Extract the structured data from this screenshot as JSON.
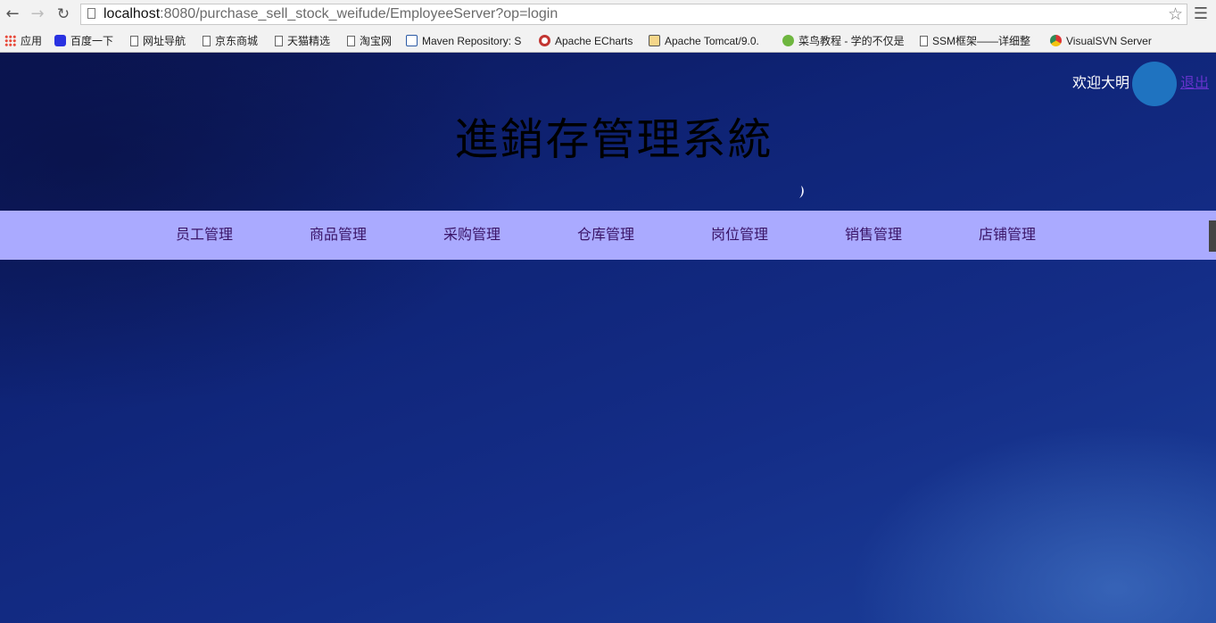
{
  "browser": {
    "url_host": "localhost",
    "url_rest": ":8080/purchase_sell_stock_weifude/EmployeeServer?op=login",
    "bookmarks": [
      {
        "label": "应用",
        "icon": "apps-icon"
      },
      {
        "label": "百度一下",
        "icon": "baidu-icon"
      },
      {
        "label": "网址导航",
        "icon": "page-icon"
      },
      {
        "label": "京东商城",
        "icon": "page-icon"
      },
      {
        "label": "天猫精选",
        "icon": "page-icon"
      },
      {
        "label": "淘宝网",
        "icon": "page-icon"
      },
      {
        "label": "Maven Repository: S",
        "icon": "maven-icon"
      },
      {
        "label": "Apache ECharts",
        "icon": "echarts-icon"
      },
      {
        "label": "Apache Tomcat/9.0.",
        "icon": "tomcat-icon"
      },
      {
        "label": "菜鸟教程 - 学的不仅是",
        "icon": "runoob-icon"
      },
      {
        "label": "SSM框架——详细整",
        "icon": "page-icon"
      },
      {
        "label": "VisualSVN Server",
        "icon": "svn-icon"
      }
    ]
  },
  "header": {
    "welcome": "欢迎大明",
    "logout": "退出",
    "title": "進銷存管理系統"
  },
  "nav": {
    "items": [
      "员工管理",
      "商品管理",
      "采购管理",
      "仓库管理",
      "岗位管理",
      "销售管理",
      "店铺管理"
    ]
  }
}
